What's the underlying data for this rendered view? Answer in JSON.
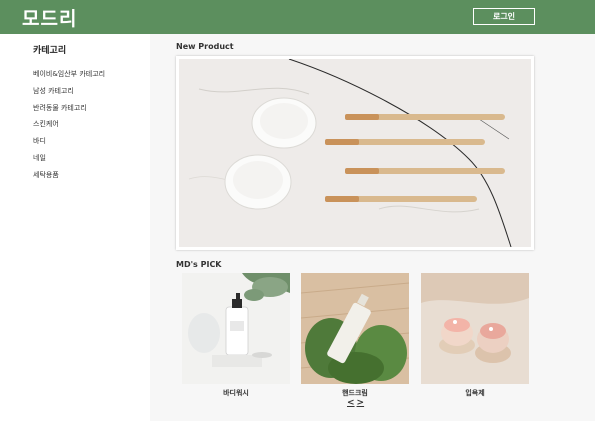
{
  "header": {
    "logo": "모드리",
    "login_label": "로그인"
  },
  "sidebar": {
    "title": "카테고리",
    "items": [
      "베이비&임산부 카테고리",
      "남성 카테고리",
      "반려동물 카테고리",
      "스킨케어",
      "바디",
      "네일",
      "세탁용품"
    ]
  },
  "new_product": {
    "title": "New Product"
  },
  "md_pick": {
    "title": "MD's PICK",
    "items": [
      {
        "label": "바디워시"
      },
      {
        "label": "핸드크림"
      },
      {
        "label": "입욕제"
      }
    ],
    "prev_label": "<",
    "next_label": ">"
  },
  "colors": {
    "header_bg": "#5c8f5e",
    "logo_text": "#ffffff",
    "main_bg": "#f7f7f7"
  }
}
